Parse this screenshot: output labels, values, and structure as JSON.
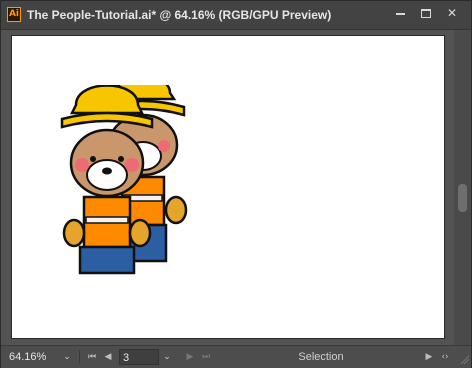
{
  "window": {
    "app_icon_text": "Ai",
    "title": "The People-Tutorial.ai* @ 64.16% (RGB/GPU Preview)",
    "controls": [
      "minimize-icon",
      "maximize-icon",
      "close-icon"
    ],
    "close_glyph": "✕"
  },
  "artwork": {
    "description_icon": "construction-worker-bears-artwork"
  },
  "status_bar": {
    "zoom_value": "64.16%",
    "page_value": "3",
    "tool_status": "Selection",
    "icons": [
      "chevron-down-icon",
      "first-artboard-icon",
      "previous-artboard-icon",
      "next-artboard-icon",
      "last-artboard-icon",
      "play-icon",
      "code-icon"
    ],
    "glyphs": {
      "dropdown": "⌄",
      "first": "⏮",
      "prev": "◀",
      "next": "▶",
      "last": "⏭",
      "play": "▶",
      "code": "‹›"
    }
  }
}
